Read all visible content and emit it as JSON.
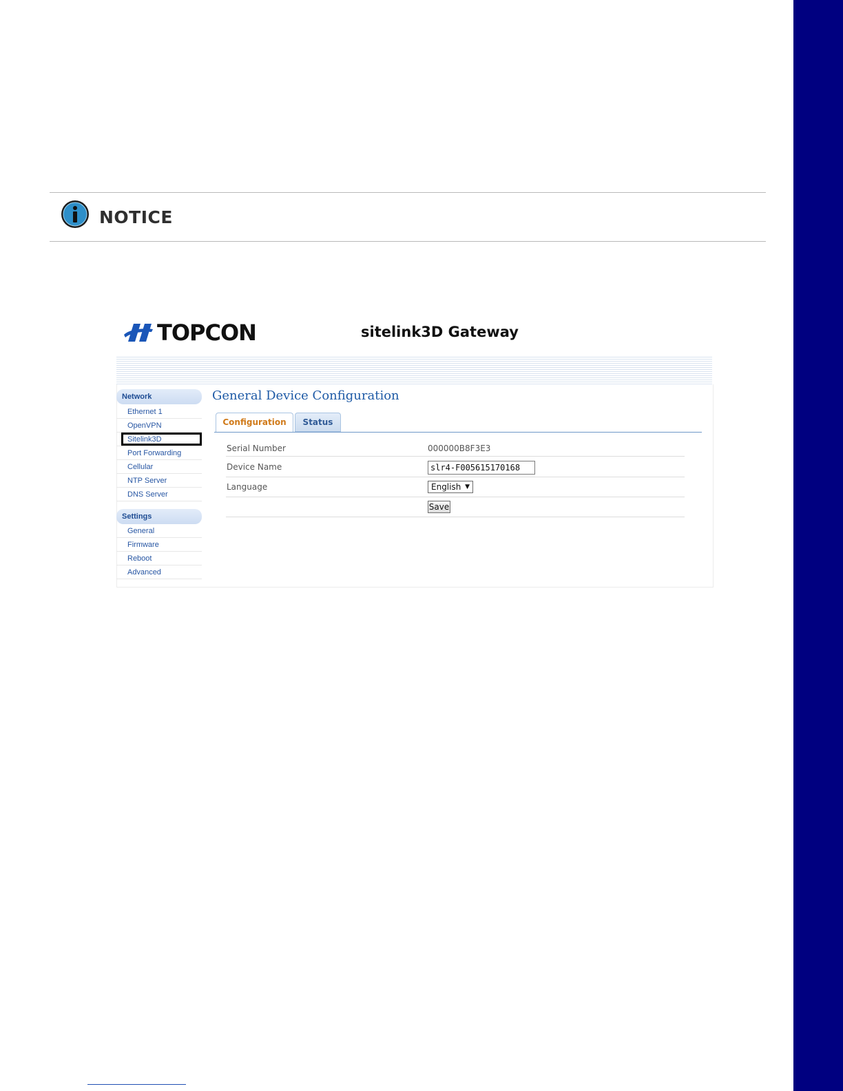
{
  "notice": {
    "label": "NOTICE",
    "icon": "info-icon"
  },
  "app": {
    "brand": "TOPCON",
    "title": "sitelink3D Gateway"
  },
  "nav": {
    "network_header": "Network",
    "network_items": [
      "Ethernet 1",
      "OpenVPN",
      "Sitelink3D",
      "Port Forwarding",
      "Cellular",
      "NTP Server",
      "DNS Server"
    ],
    "settings_header": "Settings",
    "settings_items": [
      "General",
      "Firmware",
      "Reboot",
      "Advanced"
    ]
  },
  "page": {
    "title": "General Device Configuration",
    "tabs": [
      "Configuration",
      "Status"
    ]
  },
  "form": {
    "serial_label": "Serial Number",
    "serial_value": "000000B8F3E3",
    "device_name_label": "Device Name",
    "device_name_value": "slr4-F005615170168",
    "language_label": "Language",
    "language_value": "English",
    "save_label": "Save"
  },
  "colors": {
    "side_bar": "#000080",
    "accent_blue": "#1e5aa6",
    "active_tab": "#d07a1a"
  }
}
